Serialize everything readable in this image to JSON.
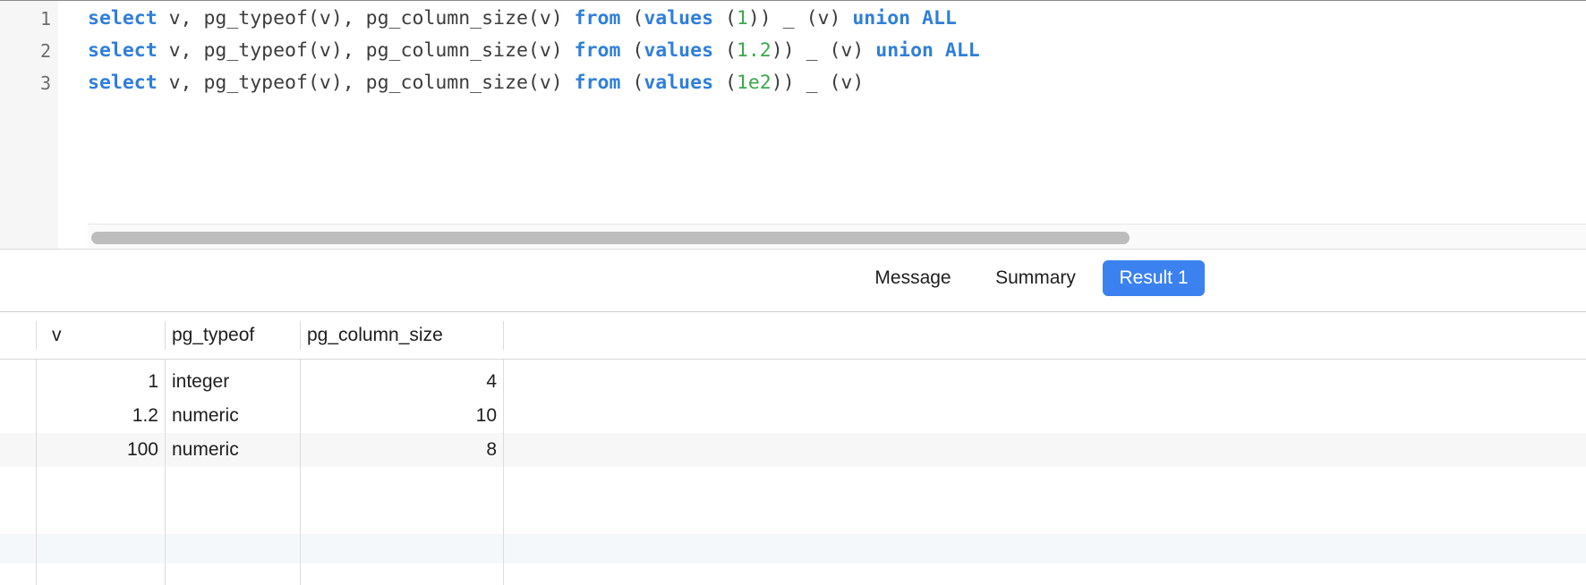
{
  "editor": {
    "line_numbers": [
      "1",
      "2",
      "3"
    ],
    "lines": [
      [
        {
          "t": "select",
          "c": "kw"
        },
        {
          "t": " v, pg_typeof(v), pg_column_size(v) ",
          "c": "punc"
        },
        {
          "t": "from",
          "c": "kw"
        },
        {
          "t": " (",
          "c": "punc"
        },
        {
          "t": "values",
          "c": "kw"
        },
        {
          "t": " (",
          "c": "punc"
        },
        {
          "t": "1",
          "c": "num"
        },
        {
          "t": ")) _ (v) ",
          "c": "punc"
        },
        {
          "t": "union ALL",
          "c": "kw"
        }
      ],
      [
        {
          "t": "select",
          "c": "kw"
        },
        {
          "t": " v, pg_typeof(v), pg_column_size(v) ",
          "c": "punc"
        },
        {
          "t": "from",
          "c": "kw"
        },
        {
          "t": " (",
          "c": "punc"
        },
        {
          "t": "values",
          "c": "kw"
        },
        {
          "t": " (",
          "c": "punc"
        },
        {
          "t": "1.2",
          "c": "num"
        },
        {
          "t": ")) _ (v) ",
          "c": "punc"
        },
        {
          "t": "union ALL",
          "c": "kw"
        }
      ],
      [
        {
          "t": "select",
          "c": "kw"
        },
        {
          "t": " v, pg_typeof(v), pg_column_size(v) ",
          "c": "punc"
        },
        {
          "t": "from",
          "c": "kw"
        },
        {
          "t": " (",
          "c": "punc"
        },
        {
          "t": "values",
          "c": "kw"
        },
        {
          "t": " (",
          "c": "punc"
        },
        {
          "t": "1e2",
          "c": "num"
        },
        {
          "t": ")) _ (v)",
          "c": "punc"
        }
      ]
    ]
  },
  "tabs": [
    {
      "label": "Message",
      "active": false
    },
    {
      "label": "Summary",
      "active": false
    },
    {
      "label": "Result 1",
      "active": true
    }
  ],
  "result": {
    "columns": [
      "v",
      "pg_typeof",
      "pg_column_size"
    ],
    "rows": [
      [
        "1",
        "integer",
        "4"
      ],
      [
        "1.2",
        "numeric",
        "10"
      ],
      [
        "100",
        "numeric",
        "8"
      ]
    ]
  },
  "colors": {
    "keyword": "#2f7fdb",
    "number": "#3aa94a",
    "active_tab": "#3b82f0"
  }
}
